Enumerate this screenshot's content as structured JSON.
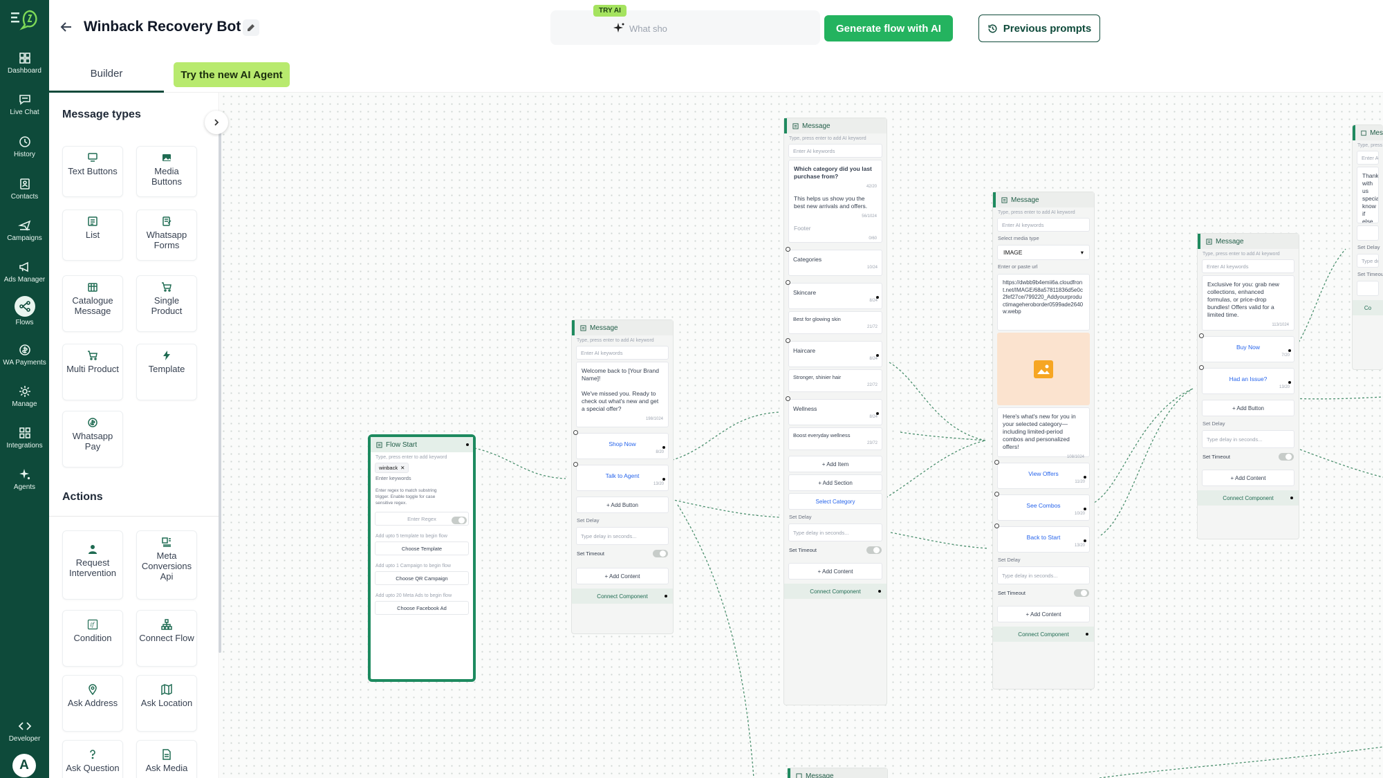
{
  "nav": {
    "items": [
      {
        "label": "Dashboard",
        "icon": "grid-icon"
      },
      {
        "label": "Live Chat",
        "icon": "chat-icon"
      },
      {
        "label": "History",
        "icon": "history-icon"
      },
      {
        "label": "Contacts",
        "icon": "contacts-icon"
      },
      {
        "label": "Campaigns",
        "icon": "send-icon"
      },
      {
        "label": "Ads Manager",
        "icon": "megaphone-icon"
      },
      {
        "label": "Flows",
        "icon": "flows-icon"
      },
      {
        "label": "WA Payments",
        "icon": "payment-icon"
      },
      {
        "label": "Manage",
        "icon": "gear-icon"
      },
      {
        "label": "Integrations",
        "icon": "integrations-icon"
      },
      {
        "label": "Agents",
        "icon": "sparkle-icon"
      },
      {
        "label": "Developer",
        "icon": "code-icon"
      }
    ],
    "avatar_initial": "A"
  },
  "header": {
    "title": "Winback Recovery Bot",
    "try_ai_badge": "TRY AI",
    "ai_placeholder": "What sho",
    "generate_label": "Generate flow with AI",
    "previous_label": "Previous prompts"
  },
  "tabs": {
    "builder": "Builder",
    "ai_agent": "Try the new AI Agent"
  },
  "sidebar": {
    "message_types_title": "Message types",
    "message_types": [
      {
        "label": "Text Buttons",
        "icon": "text-buttons-icon"
      },
      {
        "label": "Media Buttons",
        "icon": "image-icon"
      },
      {
        "label": "List",
        "icon": "list-icon"
      },
      {
        "label": "Whatsapp Forms",
        "icon": "form-icon"
      },
      {
        "label": "Catalogue Message",
        "icon": "catalogue-icon"
      },
      {
        "label": "Single Product",
        "icon": "cart-icon"
      },
      {
        "label": "Multi Product",
        "icon": "cart-icon"
      },
      {
        "label": "Template",
        "icon": "bolt-icon"
      },
      {
        "label": "Whatsapp Pay",
        "icon": "payment-icon"
      }
    ],
    "actions_title": "Actions",
    "actions": [
      {
        "label": "Request Intervention",
        "icon": "person-icon"
      },
      {
        "label": "Meta Conversions Api",
        "icon": "api-icon"
      },
      {
        "label": "Condition",
        "icon": "if-icon"
      },
      {
        "label": "Connect Flow",
        "icon": "hierarchy-icon"
      },
      {
        "label": "Ask Address",
        "icon": "pin-icon"
      },
      {
        "label": "Ask Location",
        "icon": "map-icon"
      },
      {
        "label": "Ask Question",
        "icon": "question-icon"
      },
      {
        "label": "Ask Media",
        "icon": "file-icon"
      }
    ]
  },
  "common": {
    "message_header": "Message",
    "ai_keyword_hint": "Type, press enter to add AI keyword",
    "ai_keyword_placeholder": "Enter AI keywords",
    "add_button": "+ Add Button",
    "set_delay": "Set Delay",
    "delay_placeholder": "Type delay in seconds...",
    "set_timeout": "Set Timeout",
    "add_content": "+ Add Content",
    "connect_component": "Connect Component"
  },
  "flow_start": {
    "title": "Flow Start",
    "keyword_hint": "Type, press enter to add keyword",
    "keyword_chip": "winback",
    "keyword_placeholder": "Enter keywords",
    "regex_note": "Enter regex to match substring trigger. Enable toggle for case sensitive regex.",
    "regex_placeholder": "Enter Regex",
    "template_note": "Add upto 5 template to begin flow",
    "template_btn": "Choose Template",
    "campaign_note": "Add upto 1 Campaign to begin flow",
    "campaign_btn": "Choose QR Campaign",
    "ads_note": "Add upto 20 Meta Ads to begin flow",
    "ads_btn": "Choose Facebook Ad"
  },
  "node_welcome": {
    "text": "Welcome back to [Your Brand Name]!\n\nWe've missed you. Ready to check out what's new and get a special offer?",
    "counter": "198/1024",
    "buttons": [
      {
        "label": "Shop Now",
        "counter": "8/20"
      },
      {
        "label": "Talk to Agent",
        "counter": "13/20"
      }
    ]
  },
  "node_category": {
    "text": "Which category did you last purchase from?",
    "text_counter": "42/20",
    "body": "This helps us show you the best new arrivals and offers.",
    "body_counter": "56/1024",
    "footer_placeholder": "Footer",
    "footer_counter": "0/60",
    "list_title": "Categories",
    "list_counter": "10/24",
    "items": [
      {
        "label": "Skincare",
        "counter": "8/24",
        "desc": "Best for glowing skin",
        "desc_counter": "21/72"
      },
      {
        "label": "Haircare",
        "counter": "8/24",
        "desc": "Stronger, shinier hair",
        "desc_counter": "22/72"
      },
      {
        "label": "Wellness",
        "counter": "8/24",
        "desc": "Boost everyday wellness",
        "desc_counter": "23/72"
      }
    ],
    "add_item": "+ Add Item",
    "add_section": "+ Add Section",
    "select_btn": "Select Category"
  },
  "node_media": {
    "media_type_label": "Select media type",
    "media_type": "IMAGE",
    "url_label": "Enter or paste url",
    "url": "https://dwbb9b4emii6a.cloudfront.net/IMAGE/68a57811836d5e0c2fef27ce/799220_Addyourproductimageheroborder0599ade2640w.webp",
    "caption": "Here's what's new for you in your selected category—including limited-period combos and personalized offers!",
    "caption_counter": "108/1024",
    "buttons": [
      {
        "label": "View Offers",
        "counter": "11/20"
      },
      {
        "label": "See Combos",
        "counter": "10/20"
      },
      {
        "label": "Back to Start",
        "counter": "13/20"
      }
    ]
  },
  "node_offer": {
    "text": "Exclusive for you: grab new collections, enhanced formulas, or price-drop bundles! Offers valid for a limited time.",
    "counter": "113/1024",
    "buttons": [
      {
        "label": "Buy Now",
        "counter": "7/20"
      },
      {
        "label": "Had an Issue?",
        "counter": "13/20"
      }
    ]
  },
  "node_edge": {
    "header": "Mes",
    "hint": "Type, press",
    "field": "Enter AI k",
    "text": "Thank with us special know if else.",
    "set_delay": "Set Delay",
    "delay": "Type de",
    "set_timeout": "Set Timeout",
    "connect": "Co"
  },
  "node_bottom": {
    "header": "Message"
  }
}
